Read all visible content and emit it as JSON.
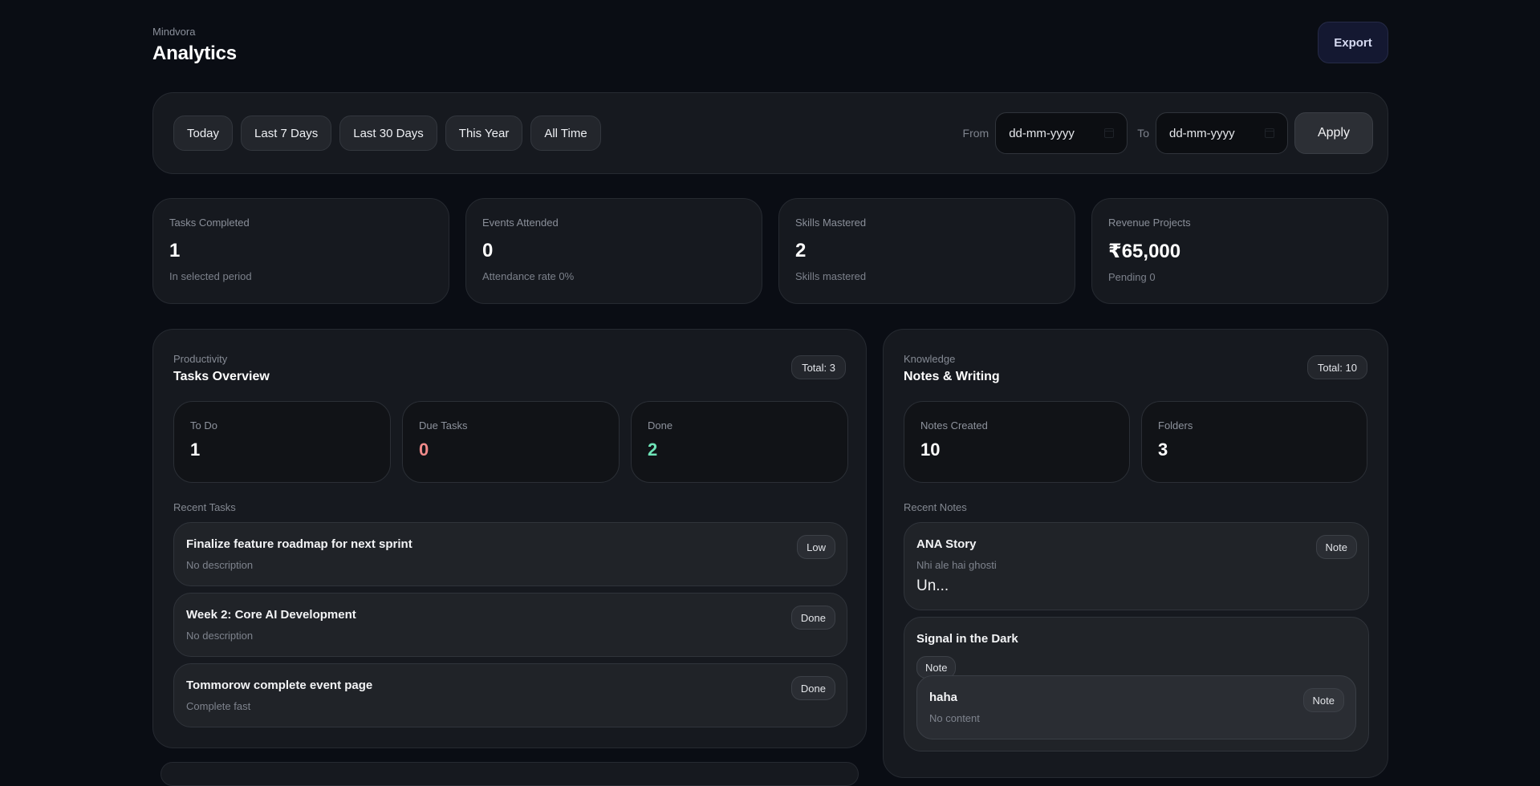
{
  "header": {
    "brand": "Mindvora",
    "title": "Analytics",
    "export_label": "Export"
  },
  "filters": {
    "ranges": [
      "Today",
      "Last 7 Days",
      "Last 30 Days",
      "This Year",
      "All Time"
    ],
    "from_label": "From",
    "to_label": "To",
    "from_placeholder": "dd-mm-yyyy",
    "to_placeholder": "dd-mm-yyyy",
    "apply_label": "Apply"
  },
  "stats": [
    {
      "label": "Tasks Completed",
      "value": "1",
      "sub": "In selected period"
    },
    {
      "label": "Events Attended",
      "value": "0",
      "sub": "Attendance rate 0%"
    },
    {
      "label": "Skills Mastered",
      "value": "2",
      "sub": "Skills mastered"
    },
    {
      "label": "Revenue Projects",
      "value": "₹65,000",
      "sub": "Pending 0"
    }
  ],
  "tasks_panel": {
    "kicker": "Productivity",
    "title": "Tasks Overview",
    "total": "Total: 3",
    "metrics": [
      {
        "label": "To Do",
        "value": "1"
      },
      {
        "label": "Due Tasks",
        "value": "0"
      },
      {
        "label": "Done",
        "value": "2"
      }
    ],
    "recent_label": "Recent Tasks",
    "recent": [
      {
        "title": "Finalize feature roadmap for next sprint",
        "desc": "No description",
        "badge": "Low"
      },
      {
        "title": "Week 2: Core AI Development",
        "desc": "No description",
        "badge": "Done"
      },
      {
        "title": "Tommorow complete event page",
        "desc": "Complete fast",
        "badge": "Done"
      }
    ]
  },
  "notes_panel": {
    "kicker": "Knowledge",
    "title": "Notes & Writing",
    "total": "Total: 10",
    "metrics": [
      {
        "label": "Notes Created",
        "value": "10"
      },
      {
        "label": "Folders",
        "value": "3"
      }
    ],
    "recent_label": "Recent Notes",
    "recent": [
      {
        "title": "ANA Story",
        "desc": "Nhi ale hai ghosti",
        "extra": "Un...",
        "badge": "Note"
      },
      {
        "title": "Signal in the Dark",
        "badge": "Note",
        "nested": {
          "title": "haha",
          "desc": "No content",
          "badge": "Note"
        }
      }
    ]
  }
}
